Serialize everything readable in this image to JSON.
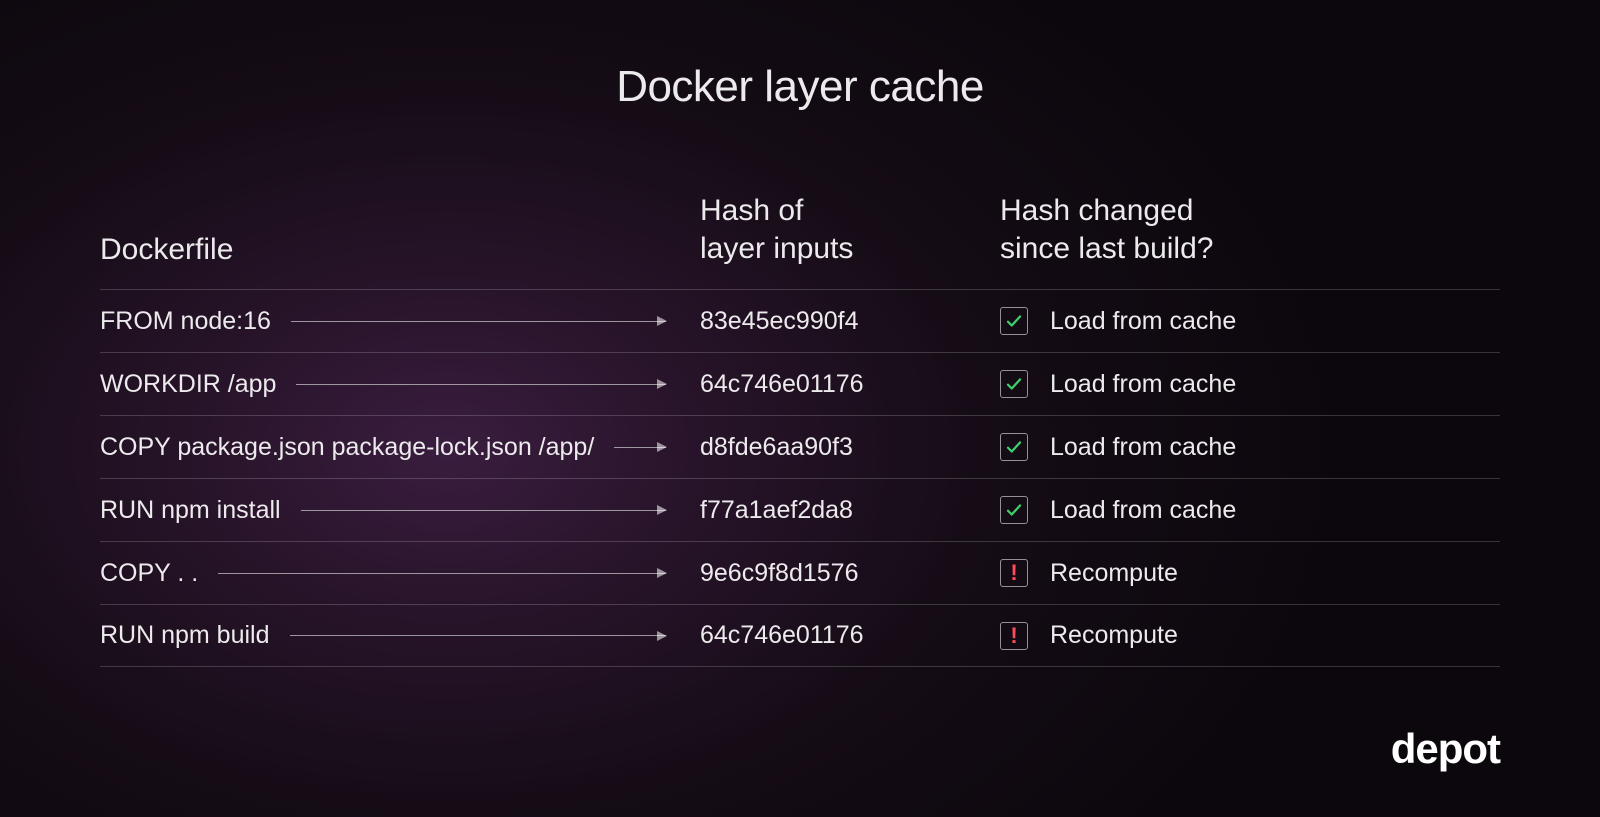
{
  "title": "Docker layer cache",
  "headers": {
    "dockerfile": "Dockerfile",
    "hash_line1": "Hash of",
    "hash_line2": "layer inputs",
    "status_line1": "Hash changed",
    "status_line2": "since last build?"
  },
  "status_labels": {
    "cache": "Load from cache",
    "recompute": "Recompute"
  },
  "rows": [
    {
      "cmd": "FROM node:16",
      "hash": "83e45ec990f4",
      "status": "cache"
    },
    {
      "cmd": "WORKDIR /app",
      "hash": "64c746e01176",
      "status": "cache"
    },
    {
      "cmd": "COPY package.json package-lock.json /app/",
      "hash": "d8fde6aa90f3",
      "status": "cache"
    },
    {
      "cmd": "RUN npm install",
      "hash": "f77a1aef2da8",
      "status": "cache"
    },
    {
      "cmd": "COPY . .",
      "hash": "9e6c9f8d1576",
      "status": "recompute"
    },
    {
      "cmd": "RUN npm build",
      "hash": "64c746e01176",
      "status": "recompute"
    }
  ],
  "logo": "depot",
  "colors": {
    "check": "#3fcf6b",
    "bang": "#ff4d5a"
  }
}
